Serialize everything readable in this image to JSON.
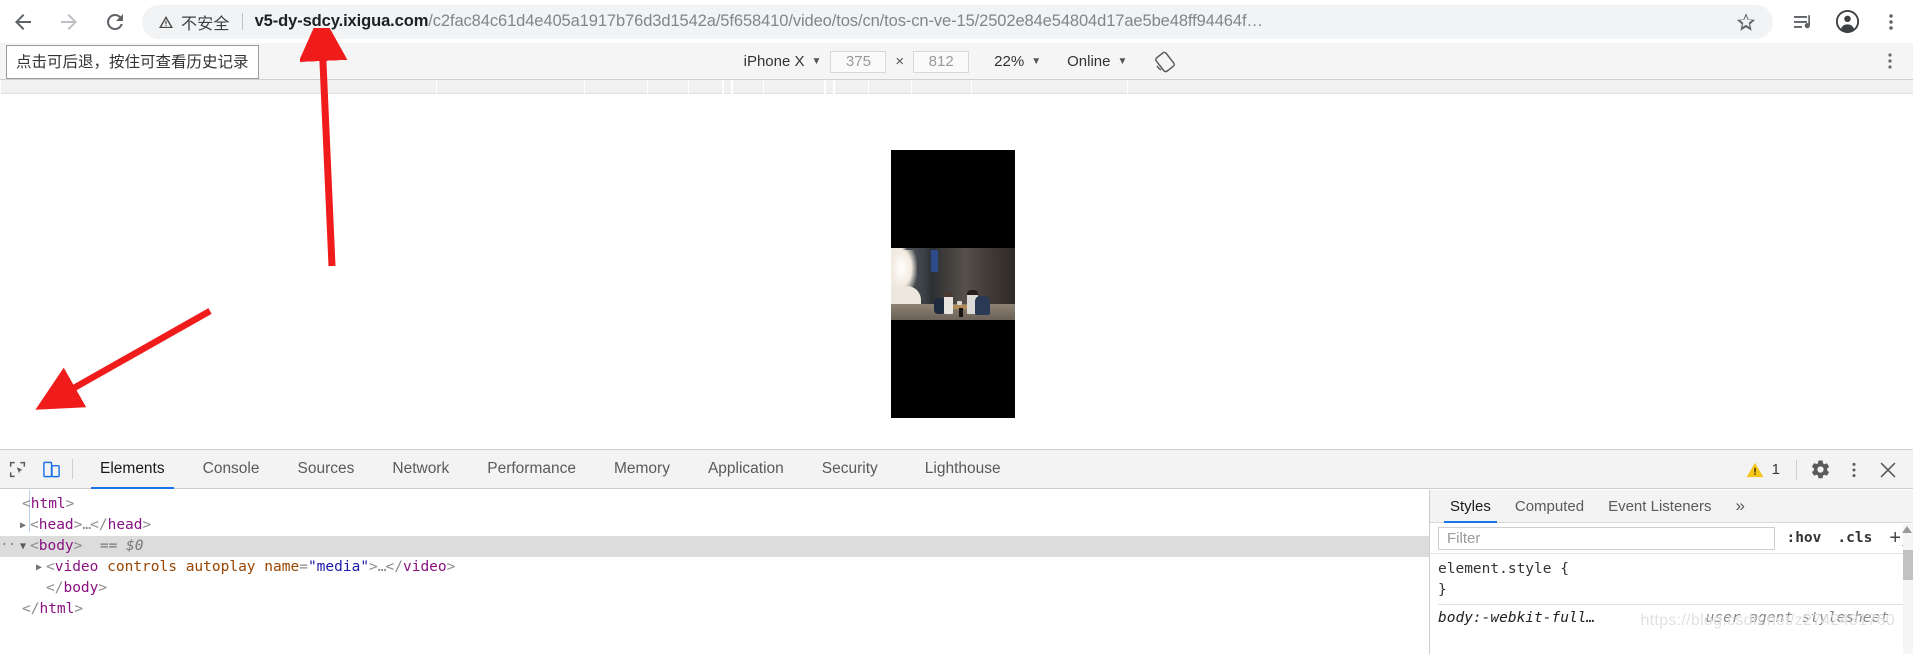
{
  "browser": {
    "nav": {
      "back_label": "back",
      "forward_label": "forward",
      "reload_label": "reload"
    },
    "security": {
      "label": "不安全",
      "icon": "warning-triangle-icon"
    },
    "url": {
      "host": "v5-dy-sdcy.ixigua.com",
      "path": "/c2fac84c61d4e405a1917b76d3d1542a/5f658410/video/tos/cn/tos-cn-ve-15/2502e84e54804d17ae5be48ff94464f…",
      "full": "v5-dy-sdcy.ixigua.com/c2fac84c61d4e405a1917b76d3d1542a/5f658410/video/tos/cn/tos-cn-ve-15/2502e84e54804d17ae5be48ff94464f…"
    },
    "actions": {
      "bookmark": "star-icon",
      "media_control": "media-list-icon",
      "profile": "account-avatar-icon",
      "menu": "kebab-menu-icon"
    },
    "tooltip": {
      "text": "点击可后退，按住可查看历史记录"
    }
  },
  "device_toolbar": {
    "device": "iPhone X",
    "width": "375",
    "height": "812",
    "dimension_separator": "×",
    "zoom": "22%",
    "throttling": "Online",
    "rotate_icon": "rotate-device-icon",
    "menu_icon": "kebab-menu-icon"
  },
  "devtools": {
    "left_icons": [
      {
        "name": "inspect-element-icon",
        "active": false
      },
      {
        "name": "device-toolbar-icon",
        "active": true
      }
    ],
    "tabs": [
      {
        "label": "Elements",
        "selected": true
      },
      {
        "label": "Console",
        "selected": false
      },
      {
        "label": "Sources",
        "selected": false
      },
      {
        "label": "Network",
        "selected": false
      },
      {
        "label": "Performance",
        "selected": false
      },
      {
        "label": "Memory",
        "selected": false
      },
      {
        "label": "Application",
        "selected": false
      },
      {
        "label": "Security",
        "selected": false
      },
      {
        "label": "Lighthouse",
        "selected": false
      }
    ],
    "warnings": {
      "icon": "warning-triangle-icon",
      "count": "1"
    },
    "right_icons": [
      {
        "name": "settings-gear-icon"
      },
      {
        "name": "kebab-menu-icon"
      },
      {
        "name": "close-icon"
      }
    ],
    "dom": [
      {
        "indent": 0,
        "arrow": "none",
        "html": "<span class=\"gry\">&lt;</span><span class=\"tw\">html</span><span class=\"gry\">&gt;</span>",
        "selected": false
      },
      {
        "indent": 1,
        "arrow": "closed",
        "html": "<span class=\"gry\">&lt;</span><span class=\"tw\">head</span><span class=\"gry\">&gt;</span><span class=\"dots\">…</span><span class=\"gry\">&lt;/</span><span class=\"tw\">head</span><span class=\"gry\">&gt;</span>",
        "selected": false
      },
      {
        "indent": 1,
        "arrow": "open",
        "html": "<span class=\"gry\">&lt;</span><span class=\"tw\">body</span><span class=\"gry\">&gt;</span>&nbsp;&nbsp;<span class=\"ital\">== $0</span>",
        "selected": true
      },
      {
        "indent": 2,
        "arrow": "closed",
        "html": "<span class=\"gry\">&lt;</span><span class=\"tw\">video</span> <span class=\"pnk\">controls</span> <span class=\"pnk\">autoplay</span> <span class=\"pnk\">name</span><span class=\"gry\">=</span><span class=\"blu\">\"media\"</span><span class=\"gry\">&gt;</span><span class=\"dots\">…</span><span class=\"gry\">&lt;/</span><span class=\"tw\">video</span><span class=\"gry\">&gt;</span>",
        "selected": false
      },
      {
        "indent": 2,
        "arrow": "none",
        "html": "<span class=\"gry\">&lt;/</span><span class=\"tw\">body</span><span class=\"gry\">&gt;</span>",
        "selected": false
      },
      {
        "indent": 0,
        "arrow": "none",
        "html": "<span class=\"gry\">&lt;/</span><span class=\"tw\">html</span><span class=\"gry\">&gt;</span>",
        "selected": false
      }
    ],
    "dom_text": {
      "line1": "<html>",
      "line2": "<head>…</head>",
      "line3": "<body>  == $0",
      "line4": "<video controls autoplay name=\"media\">…</video>",
      "line5": "</body>",
      "line6": "</html>"
    },
    "styles": {
      "tabs": [
        {
          "label": "Styles",
          "selected": true
        },
        {
          "label": "Computed",
          "selected": false
        },
        {
          "label": "Event Listeners",
          "selected": false
        }
      ],
      "more_label": "»",
      "filter_placeholder": "Filter",
      "hov_label": ":hov",
      "cls_label": ".cls",
      "plus_label": "+",
      "rules": [
        {
          "selector": "element.style {",
          "source": "",
          "close": "}"
        },
        {
          "selector": "body:-webkit-full…",
          "source": "user agent stylesheet",
          "close": ""
        }
      ]
    }
  },
  "page": {
    "video": {
      "element": "video-preview",
      "alt": "Cafe scene with two people seated at a table, letterboxed on black"
    }
  },
  "watermark": {
    "text": "https://blog.csdn.net/z2742431760"
  },
  "colors": {
    "accent": "#1a73e8",
    "warning": "#f5c51a",
    "annotation": "#f01c1c",
    "omnibox_bg": "#f1f3f4",
    "toolbar_bg": "#f5f5f5"
  }
}
